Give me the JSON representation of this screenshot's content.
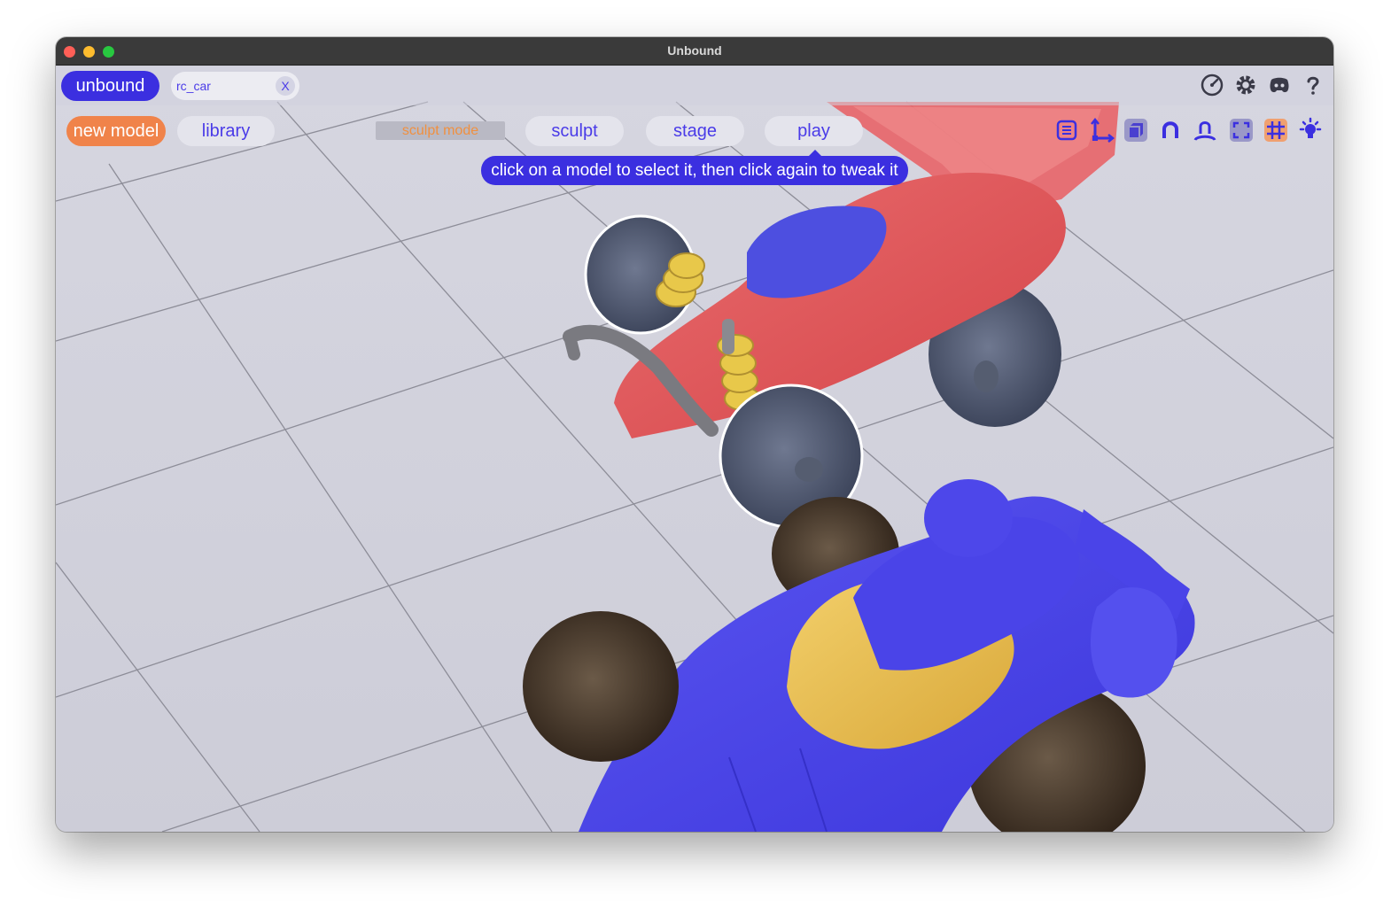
{
  "window": {
    "title": "Unbound"
  },
  "header": {
    "brand_label": "unbound",
    "file_tab": {
      "name": "rc_car",
      "close_label": "X"
    },
    "right_icons": [
      "performance-gauge-icon",
      "settings-gear-icon",
      "discord-icon",
      "help-icon"
    ]
  },
  "toolbar": {
    "new_model_label": "new model",
    "library_label": "library",
    "mode_label": "sculpt mode",
    "tabs": [
      {
        "label": "sculpt"
      },
      {
        "label": "stage"
      },
      {
        "label": "play",
        "active": true
      }
    ],
    "tools": [
      "outline-panel-icon",
      "axis-transform-icon",
      "cube-shading-icon",
      "magnet-snap-icon",
      "user-pin-icon",
      "frame-bounds-icon",
      "grid-icon",
      "light-bulb-icon"
    ],
    "hint_text": "click on a model to select it, then click again to tweak it"
  },
  "colors": {
    "accent": "#3b2fe0",
    "orange": "#f0834a",
    "red_car": "#e05055",
    "blue_car": "#4a44e8",
    "yellow": "#e8c055"
  }
}
